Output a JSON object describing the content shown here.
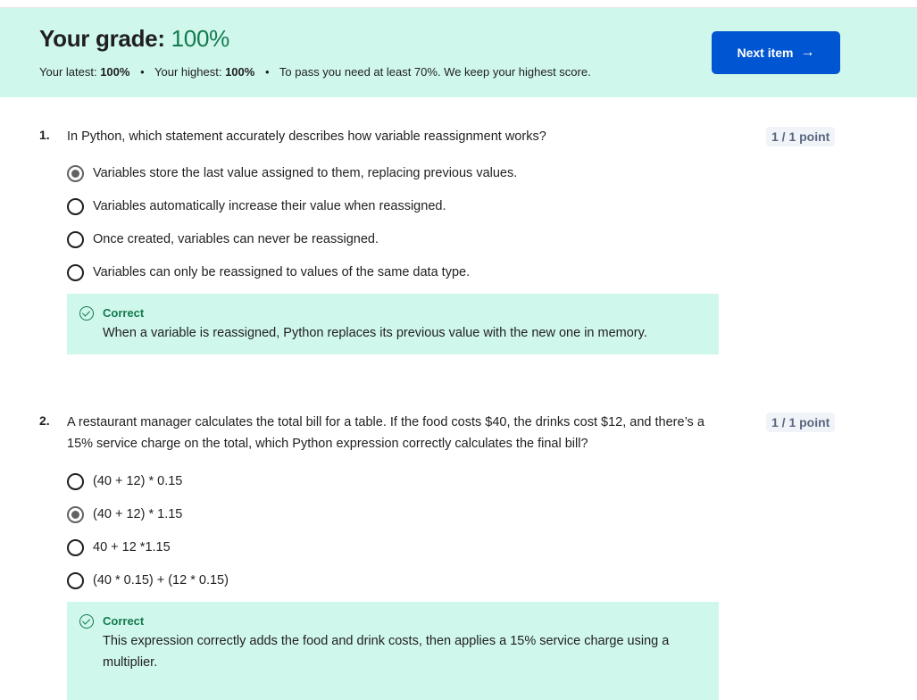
{
  "banner": {
    "grade_label": "Your grade:",
    "grade_value": "100%",
    "latest_label": "Your latest:",
    "latest_value": "100%",
    "highest_label": "Your highest:",
    "highest_value": "100%",
    "pass_text": "To pass you need at least 70%. We keep your highest score.",
    "separator": "•",
    "next_button": "Next item",
    "next_icon": "arrow-right-icon"
  },
  "questions": [
    {
      "number": "1.",
      "text": "In Python, which statement accurately describes how variable reassignment works?",
      "points": "1 / 1 point",
      "options": [
        {
          "label": "Variables store the last value assigned to them, replacing previous values.",
          "selected": true
        },
        {
          "label": "Variables automatically increase their value when reassigned.",
          "selected": false
        },
        {
          "label": "Once created, variables can never be reassigned.",
          "selected": false
        },
        {
          "label": "Variables can only be reassigned to values of the same data type.",
          "selected": false
        }
      ],
      "feedback": {
        "title": "Correct",
        "text": "When a variable is reassigned, Python replaces its previous value with the new one in memory."
      }
    },
    {
      "number": "2.",
      "text": "A restaurant manager calculates the total bill for a table. If the food costs $40, the drinks cost $12, and there’s a 15% service charge on the total, which Python expression correctly calculates the final bill?",
      "points": "1 / 1 point",
      "options": [
        {
          "label": "(40 + 12) * 0.15",
          "selected": false
        },
        {
          "label": "(40 + 12) * 1.15",
          "selected": true
        },
        {
          "label": "40 + 12 *1.15",
          "selected": false
        },
        {
          "label": "(40 * 0.15) + (12 * 0.15)",
          "selected": false
        }
      ],
      "feedback": {
        "title": "Correct",
        "text": "This expression correctly adds the food and drink costs, then applies a 15% service charge using a multiplier."
      }
    }
  ],
  "colors": {
    "banner_bg": "#d0f7ec",
    "grade_green": "#137a4e",
    "primary_blue": "#0056d2"
  }
}
